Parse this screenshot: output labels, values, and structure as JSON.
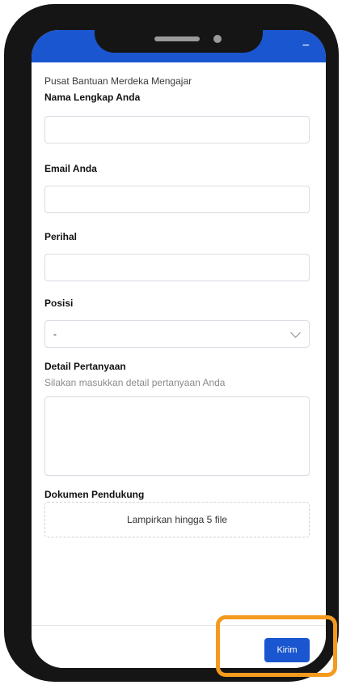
{
  "header": {
    "minimize_icon": "−"
  },
  "form": {
    "page_title": "Pusat Bantuan Merdeka Mengajar",
    "name_label": "Nama Lengkap Anda",
    "email_label": "Email Anda",
    "subject_label": "Perihal",
    "position_label": "Posisi",
    "position_value": "-",
    "details_label": "Detail Pertanyaan",
    "details_hint": "Silakan masukkan detail pertanyaan Anda",
    "attachments_label": "Dokumen Pendukung",
    "attachments_button": "Lampirkan hingga 5 file",
    "submit_label": "Kirim"
  },
  "colors": {
    "primary": "#1a56cf",
    "highlight": "#f49a1f"
  }
}
